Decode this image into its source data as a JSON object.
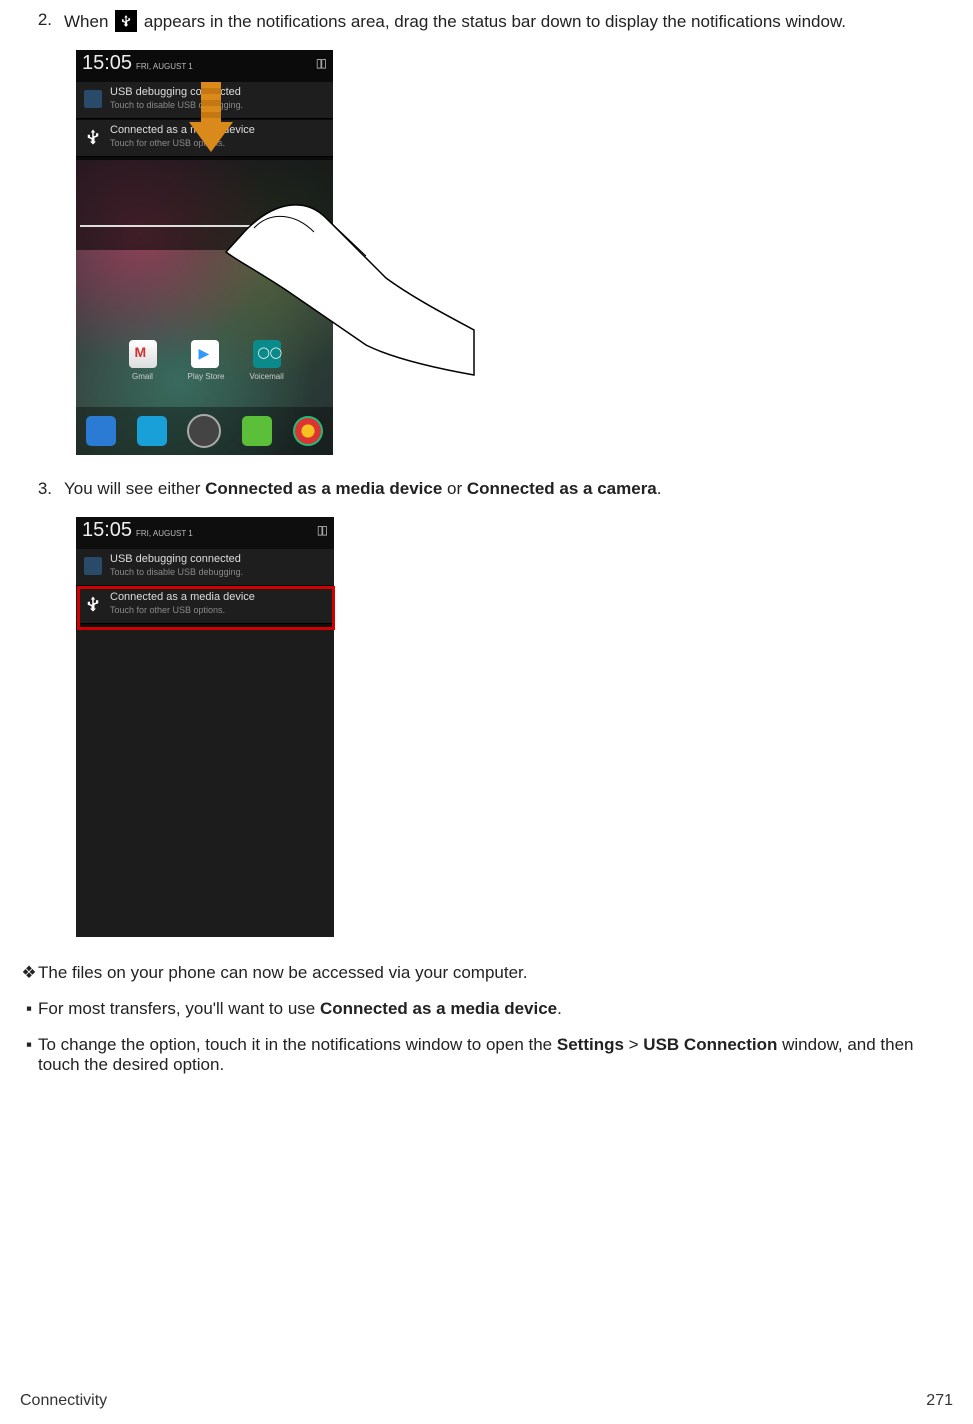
{
  "step2": {
    "num": "2.",
    "pre": "When ",
    "post": " appears in the notifications area, drag the status bar down to display the notifications window."
  },
  "step3": {
    "num": "3.",
    "pre": "You will see either ",
    "b1": "Connected as a media device",
    "mid": " or ",
    "b2": "Connected as a camera",
    "post": "."
  },
  "shot": {
    "clock": "15:05",
    "clock_sub": "FRI, AUGUST 1",
    "status_icons": "▯▯",
    "notif1_title": "USB debugging connected",
    "notif1_sub": "Touch to disable USB debugging.",
    "notif2_title": "Connected as a media device",
    "notif2_sub": "Touch for other USB options.",
    "apps": {
      "a1": "Gmail",
      "a2": "Play Store",
      "a3": "Voicemail"
    }
  },
  "bullets": {
    "diamond": "❖",
    "square": "▪",
    "b1": "The files on your phone can now be accessed via your computer.",
    "b2_pre": "For most transfers, you'll want to use ",
    "b2_bold": "Connected as a media device",
    "b2_post": ".",
    "b3_pre": "To change the option, touch it in the notifications window to open the ",
    "b3_bold1": "Settings",
    "b3_mid": " > ",
    "b3_bold2": "USB Connection",
    "b3_post": " window, and then touch the desired option."
  },
  "footer": {
    "section": "Connectivity",
    "page": "271"
  }
}
